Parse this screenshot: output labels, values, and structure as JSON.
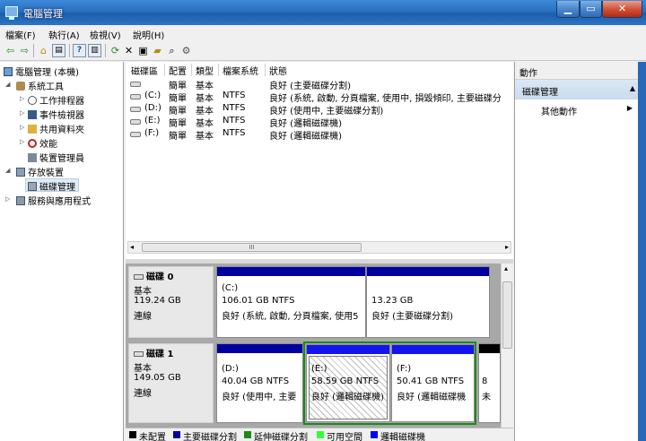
{
  "window": {
    "title": "電腦管理",
    "min_label": "▁",
    "max_label": "▭",
    "close_label": "✕"
  },
  "menu": [
    "檔案(F)",
    "執行(A)",
    "檢視(V)",
    "說明(H)"
  ],
  "tree": [
    {
      "label": "電腦管理 (本機)",
      "icon": "computer-icon"
    },
    {
      "label": "系統工具",
      "icon": "tools-icon"
    },
    {
      "label": "工作排程器",
      "icon": "clock-icon"
    },
    {
      "label": "事件檢視器",
      "icon": "event-viewer-icon"
    },
    {
      "label": "共用資料夾",
      "icon": "shared-folder-icon"
    },
    {
      "label": "效能",
      "icon": "performance-icon"
    },
    {
      "label": "裝置管理員",
      "icon": "device-manager-icon"
    },
    {
      "label": "存放裝置",
      "icon": "storage-icon"
    },
    {
      "label": "磁碟管理",
      "icon": "disk-icon"
    },
    {
      "label": "服務與應用程式",
      "icon": "services-icon"
    }
  ],
  "volumes": {
    "headers": [
      "磁碟區",
      "配置",
      "類型",
      "檔案系統",
      "狀態"
    ],
    "rows": [
      {
        "name": "",
        "layout": "簡單",
        "type": "基本",
        "fs": "",
        "status": "良好 (主要磁碟分割)"
      },
      {
        "name": "(C:)",
        "layout": "簡單",
        "type": "基本",
        "fs": "NTFS",
        "status": "良好 (系統, 啟動, 分頁檔案, 使用中, 損毀傾印, 主要磁碟分"
      },
      {
        "name": "(D:)",
        "layout": "簡單",
        "type": "基本",
        "fs": "NTFS",
        "status": "良好 (使用中, 主要磁碟分割)"
      },
      {
        "name": "(E:)",
        "layout": "簡單",
        "type": "基本",
        "fs": "NTFS",
        "status": "良好 (邏輯磁碟機)"
      },
      {
        "name": "(F:)",
        "layout": "簡單",
        "type": "基本",
        "fs": "NTFS",
        "status": "良好 (邏輯磁碟機)"
      }
    ],
    "scroll_thumb": "III"
  },
  "disks": [
    {
      "name": "磁碟 0",
      "type": "基本",
      "size": "119.24 GB",
      "state": "連線",
      "partitions": [
        {
          "drive": "(C:)",
          "size": "106.01 GB NTFS",
          "status": "良好 (系統, 啟動, 分頁檔案, 使用5"
        },
        {
          "drive": "",
          "size": "13.23 GB",
          "status": "良好 (主要磁碟分割)"
        }
      ]
    },
    {
      "name": "磁碟 1",
      "type": "基本",
      "size": "149.05 GB",
      "state": "連線",
      "partitions": [
        {
          "drive": "(D:)",
          "size": "40.04 GB NTFS",
          "status": "良好 (使用中, 主要"
        },
        {
          "drive": "(E:)",
          "size": "58.59 GB NTFS",
          "status": "良好 (邏輯磁碟機)"
        },
        {
          "drive": "(F:)",
          "size": "50.41 GB NTFS",
          "status": "良好 (邏輯磁碟機"
        },
        {
          "drive": "",
          "size": "8",
          "status": "未"
        }
      ]
    }
  ],
  "legend": [
    {
      "label": "未配置",
      "color": "#000000"
    },
    {
      "label": "主要磁碟分割",
      "color": "#0000a0"
    },
    {
      "label": "延伸磁碟分割",
      "color": "#1a8a1a"
    },
    {
      "label": "可用空間",
      "color": "#33ff33"
    },
    {
      "label": "邏輯磁碟機",
      "color": "#0000ff"
    }
  ],
  "actions": {
    "header": "動作",
    "group": "磁碟管理",
    "more": "其他動作"
  }
}
